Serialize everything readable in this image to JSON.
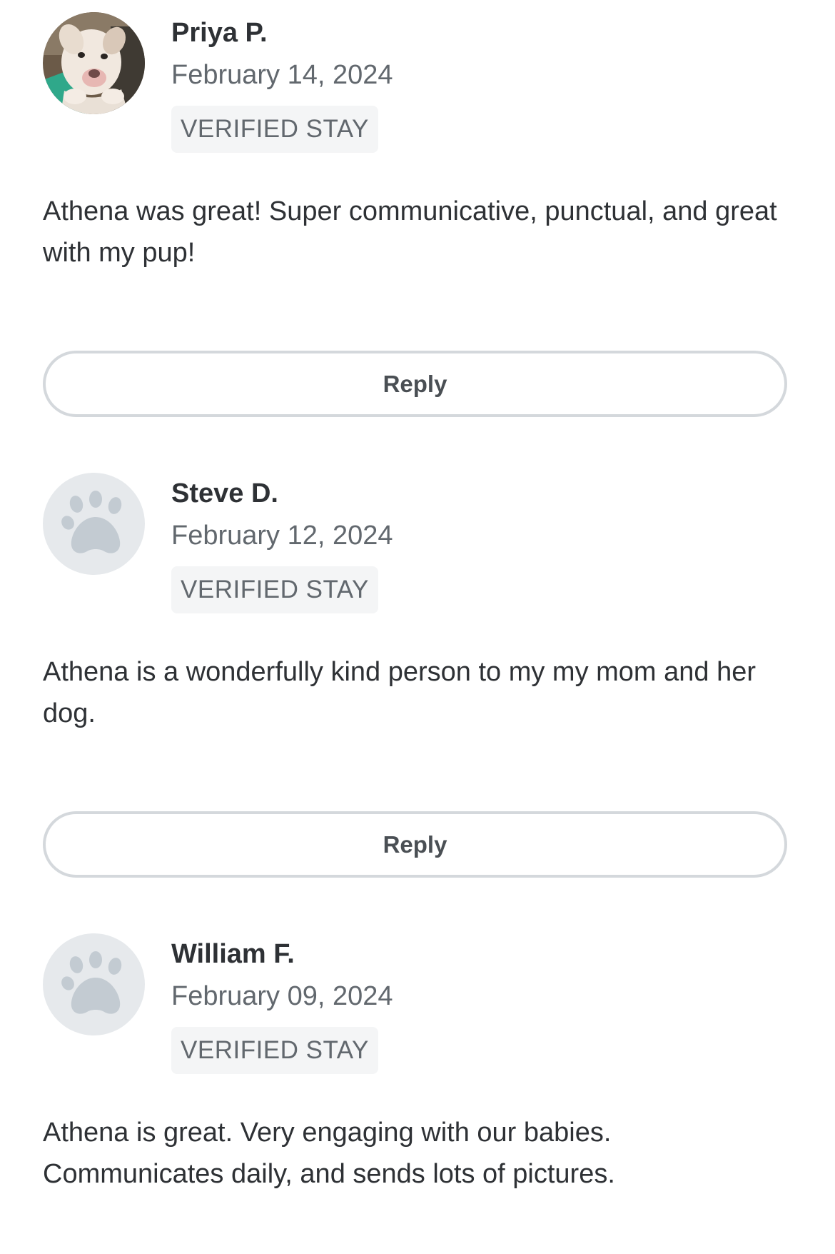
{
  "reviews": [
    {
      "name": "Priya P.",
      "date": "February 14, 2024",
      "badge": "VERIFIED STAY",
      "text": "Athena was great! Super communicative, punctual, and great with my pup!",
      "avatar": "dog-photo-avatar",
      "reply_label": "Reply"
    },
    {
      "name": "Steve D.",
      "date": "February 12, 2024",
      "badge": "VERIFIED STAY",
      "text": "Athena is a wonderfully kind person to my my mom and her dog.",
      "avatar": "paw-icon",
      "reply_label": "Reply"
    },
    {
      "name": "William F.",
      "date": "February 09, 2024",
      "badge": "VERIFIED STAY",
      "text": "Athena is great. Very engaging with our babies. Communicates daily, and sends lots of pictures.",
      "avatar": "paw-icon"
    }
  ],
  "colors": {
    "name_text": "#2e3135",
    "muted_text": "#62686e",
    "badge_bg": "#f4f5f6",
    "placeholder_bg": "#e6e9ec",
    "paw": "#c3cbd2",
    "button_border": "#d4d8dc"
  }
}
